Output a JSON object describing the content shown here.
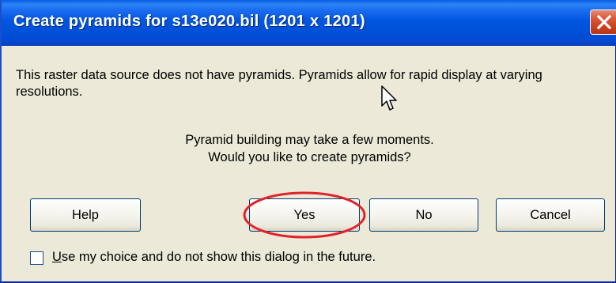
{
  "window": {
    "title": "Create pyramids for s13e020.bil (1201 x 1201)"
  },
  "dialog": {
    "message": "This raster data source does not have pyramids. Pyramids allow for rapid display at varying resolutions.",
    "info_line1": "Pyramid building may take a few moments.",
    "question": "Would you like to create pyramids?"
  },
  "buttons": {
    "help": "Help",
    "yes": "Yes",
    "no": "No",
    "cancel": "Cancel"
  },
  "checkbox": {
    "label": "Use my choice and do not show this dialog in the future.",
    "checked": false
  },
  "icons": {
    "close": "close-icon",
    "cursor": "mouse-pointer-icon"
  },
  "colors": {
    "title_bar": "#0054e3",
    "close_button": "#d9583a",
    "dialog_bg": "#ece9d8",
    "highlight": "#e0232b"
  }
}
